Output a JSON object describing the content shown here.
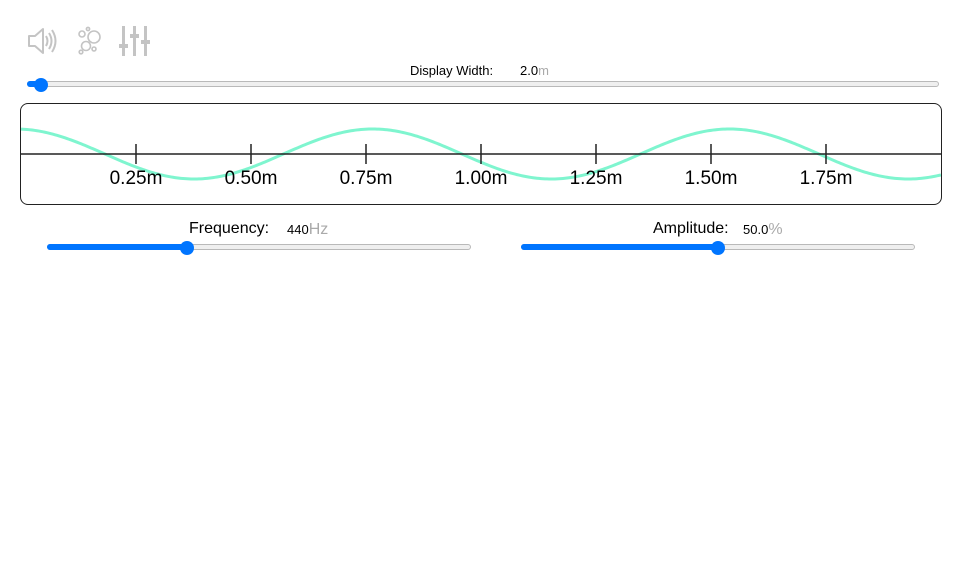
{
  "toolbar": {
    "icons": [
      {
        "name": "speaker-icon"
      },
      {
        "name": "bubbles-icon"
      },
      {
        "name": "equalizer-icon"
      }
    ],
    "icon_color": "#c4c4c4"
  },
  "display_width": {
    "label": "Display Width:",
    "value": "2.0",
    "unit": "m",
    "fraction": 0.015
  },
  "wave": {
    "color": "#7ff5cf",
    "axis_color": "#222222",
    "tick_labels": [
      "0.25m",
      "0.50m",
      "0.75m",
      "1.00m",
      "1.25m",
      "1.50m",
      "1.75m"
    ],
    "tick_values": [
      0.25,
      0.5,
      0.75,
      1.0,
      1.25,
      1.5,
      1.75
    ]
  },
  "frequency": {
    "label": "Frequency:",
    "value": "440",
    "unit": "Hz",
    "fraction": 0.33
  },
  "amplitude": {
    "label": "Amplitude:",
    "value": "50.0",
    "unit": "%",
    "fraction": 0.5
  },
  "accent_color": "#0075ff"
}
